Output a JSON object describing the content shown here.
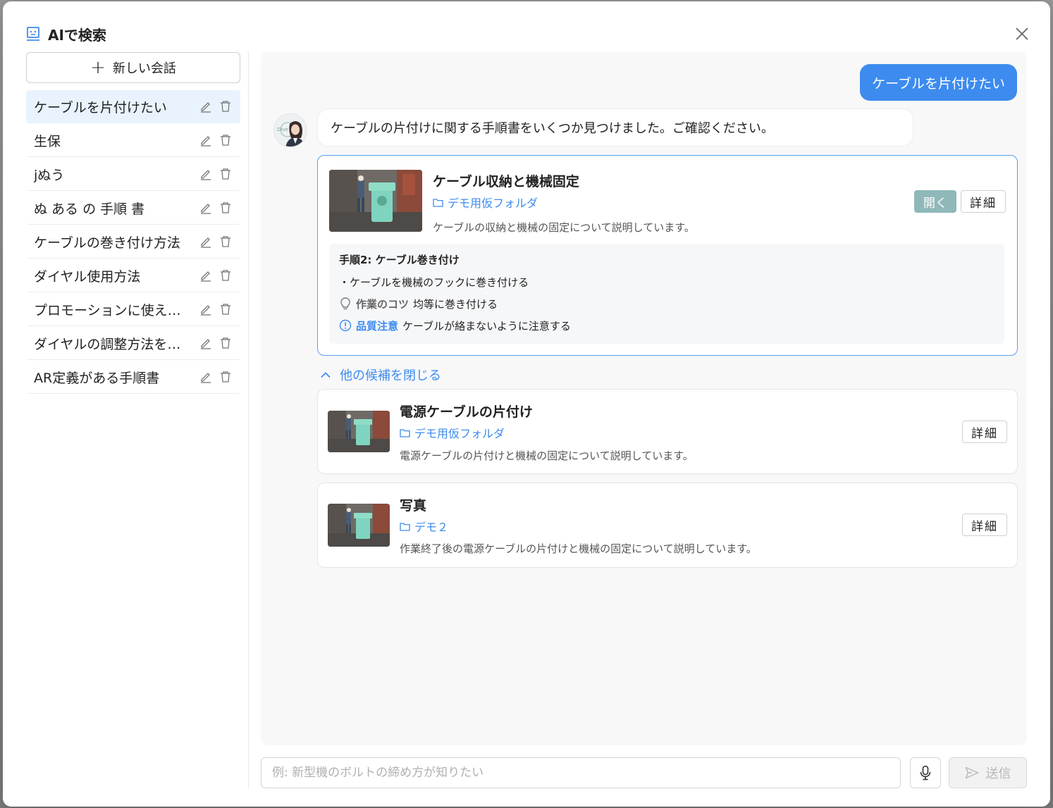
{
  "modal": {
    "title": "AIで検索"
  },
  "sidebar": {
    "new_chat_label": "新しい会話",
    "items": [
      {
        "label": "ケーブルを片付けたい",
        "active": true
      },
      {
        "label": "生保",
        "active": false
      },
      {
        "label": "jぬう",
        "active": false
      },
      {
        "label": "ぬ ある の 手順 書",
        "active": false
      },
      {
        "label": "ケーブルの巻き付け方法",
        "active": false
      },
      {
        "label": "ダイヤル使用方法",
        "active": false
      },
      {
        "label": "プロモーションに使え…",
        "active": false
      },
      {
        "label": "ダイヤルの調整方法を…",
        "active": false
      },
      {
        "label": "AR定義がある手順書",
        "active": false
      }
    ]
  },
  "chat": {
    "user_message": "ケーブルを片付けたい",
    "bot_message": "ケーブルの片付けに関する手順書をいくつか見つけました。ご確認ください。",
    "avatar_text": "Dive",
    "primary_result": {
      "title": "ケーブル収納と機械固定",
      "folder": "デモ用仮フォルダ",
      "description": "ケーブルの収納と機械の固定について説明しています。",
      "open_label": "開く",
      "detail_label": "詳細",
      "step_title": "手順2: ケーブル巻き付け",
      "step_bullet": "・ケーブルを機械のフックに巻き付ける",
      "tip_label": "作業のコツ",
      "tip_text": "均等に巻き付ける",
      "note_label": "品質注意",
      "note_text": "ケーブルが絡まないように注意する"
    },
    "collapse_label": "他の候補を閉じる",
    "other_results": [
      {
        "title": "電源ケーブルの片付け",
        "folder": "デモ用仮フォルダ",
        "description": "電源ケーブルの片付けと機械の固定について説明しています。",
        "detail_label": "詳細"
      },
      {
        "title": "写真",
        "folder": "デモ２",
        "description": "作業終了後の電源ケーブルの片付けと機械の固定について説明しています。",
        "detail_label": "詳細"
      }
    ]
  },
  "input": {
    "placeholder": "例: 新型機のボルトの締め方が知りたい",
    "send_label": "送信"
  },
  "colors": {
    "accent": "#3d8bef",
    "open_button": "#8fb8b9",
    "active_item_bg": "#e8f3fd"
  }
}
